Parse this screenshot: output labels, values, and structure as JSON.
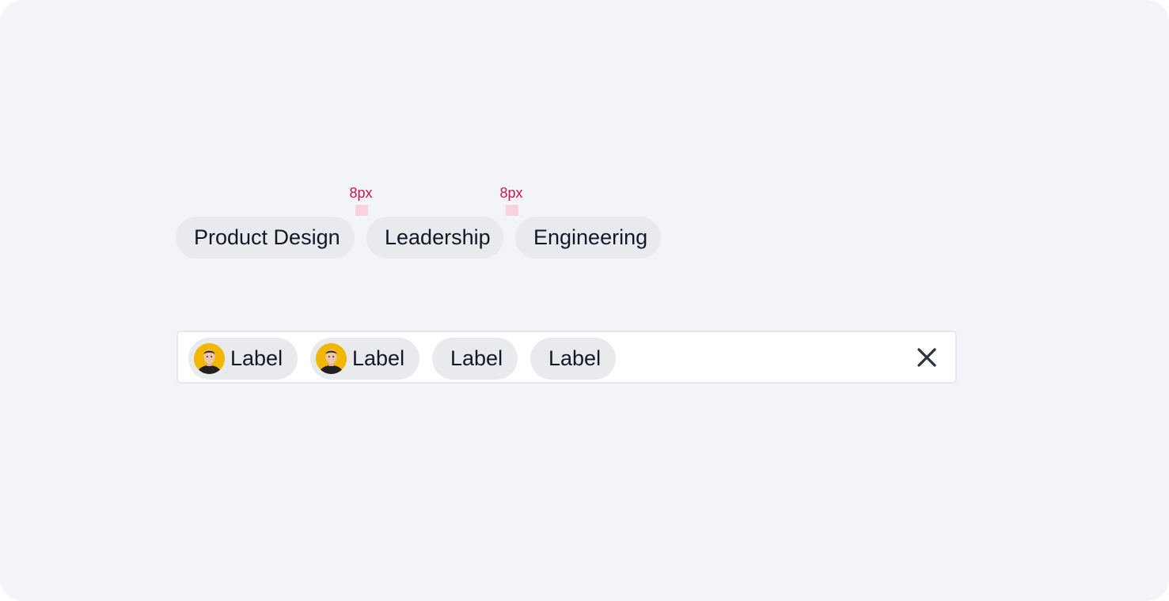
{
  "spacing": {
    "gap_label_1": "8px",
    "gap_label_2": "8px"
  },
  "tags": [
    {
      "label": "Product Design"
    },
    {
      "label": "Leadership"
    },
    {
      "label": "Engineering"
    }
  ],
  "multi_select": {
    "chips": [
      {
        "label": "Label",
        "avatar": true
      },
      {
        "label": "Label",
        "avatar": true
      },
      {
        "label": "Label",
        "avatar": false
      },
      {
        "label": "Label",
        "avatar": false
      }
    ],
    "clear_icon": "close-icon"
  },
  "colors": {
    "canvas_bg": "#f3f4f8",
    "chip_bg": "#e8eaee",
    "chip_text": "#111827",
    "spacing_annotation": "#c8174f",
    "spacing_box": "#fad1dc",
    "avatar_bg": "#f2b705",
    "clear_icon": "#2b3340"
  }
}
